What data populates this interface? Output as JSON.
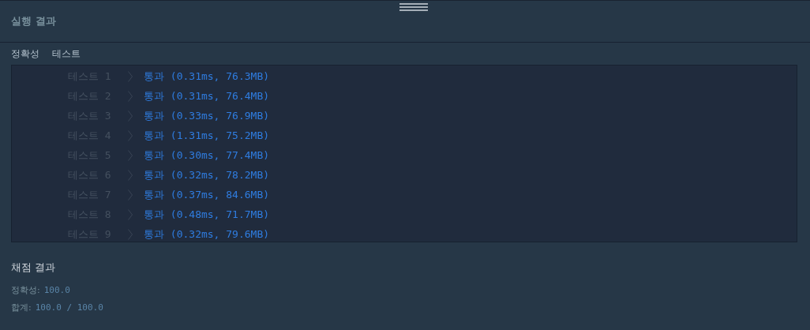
{
  "panel": {
    "title": "실행 결과"
  },
  "labels": [
    "정확성",
    "테스트"
  ],
  "results": [
    {
      "test": "테스트 1",
      "result": "통과 (0.31ms, 76.3MB)"
    },
    {
      "test": "테스트 2",
      "result": "통과 (0.31ms, 76.4MB)"
    },
    {
      "test": "테스트 3",
      "result": "통과 (0.33ms, 76.9MB)"
    },
    {
      "test": "테스트 4",
      "result": "통과 (1.31ms, 75.2MB)"
    },
    {
      "test": "테스트 5",
      "result": "통과 (0.30ms, 77.4MB)"
    },
    {
      "test": "테스트 6",
      "result": "통과 (0.32ms, 78.2MB)"
    },
    {
      "test": "테스트 7",
      "result": "통과 (0.37ms, 84.6MB)"
    },
    {
      "test": "테스트 8",
      "result": "통과 (0.48ms, 71.7MB)"
    },
    {
      "test": "테스트 9",
      "result": "통과 (0.32ms, 79.6MB)"
    }
  ],
  "grading": {
    "title": "채점 결과",
    "lines": [
      {
        "label": "정확성:",
        "value": "100.0"
      },
      {
        "label": "합계:",
        "value": "100.0 / 100.0"
      }
    ]
  }
}
